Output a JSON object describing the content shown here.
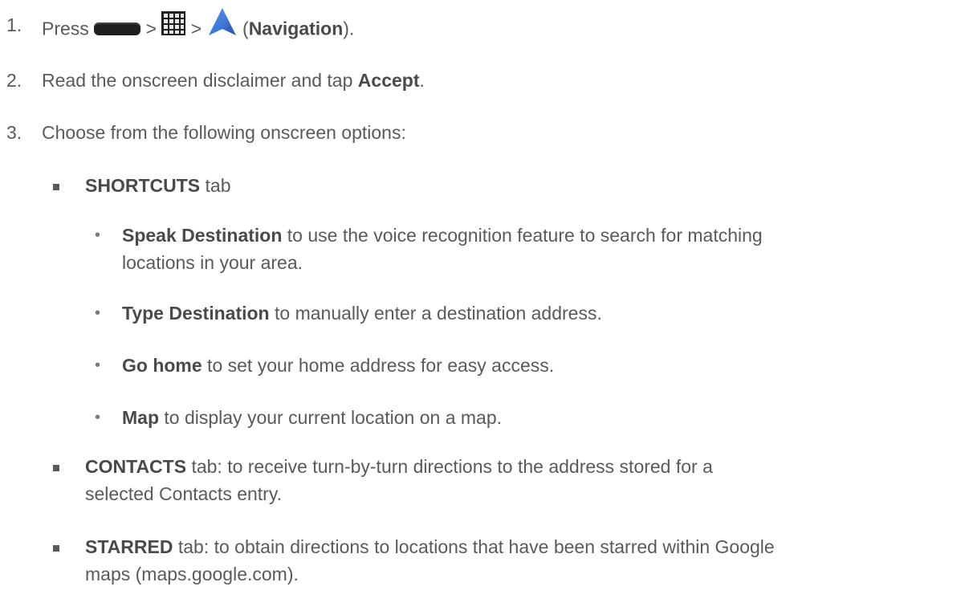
{
  "steps": [
    {
      "num": "1.",
      "press": "Press",
      "gt1": ">",
      "gt2": ">",
      "open": "(",
      "nav": "Navigation",
      "close": ")."
    },
    {
      "num": "2.",
      "text": "Read the onscreen disclaimer and tap ",
      "bold": "Accept",
      "end": "."
    },
    {
      "num": "3.",
      "text": "Choose from the following onscreen options:"
    }
  ],
  "icons": {
    "home_button": "home-key-icon",
    "apps": "apps-grid-icon",
    "navigation": "navigation-arrow-icon"
  },
  "shortcuts": {
    "bold": "SHORTCUTS",
    "rest": " tab"
  },
  "sub": [
    {
      "bold": "Speak Destination",
      "rest": " to use the voice recognition feature to search for matching",
      "rest2": "locations in your area."
    },
    {
      "bold": "Type Destination",
      "rest": " to manually enter a destination address."
    },
    {
      "bold": "Go home",
      "rest": " to set your home address for easy access."
    },
    {
      "bold": "Map",
      "rest": " to display your current location on a map."
    }
  ],
  "contacts": {
    "bold": "CONTACTS",
    "rest": " tab: to receive turn-by-turn directions to the address stored for a",
    "rest2": "selected Contacts entry."
  },
  "starred": {
    "bold": "STARRED",
    "rest": " tab: to obtain directions to locations that have been starred within Google",
    "rest2": "maps (maps.google.com)."
  }
}
